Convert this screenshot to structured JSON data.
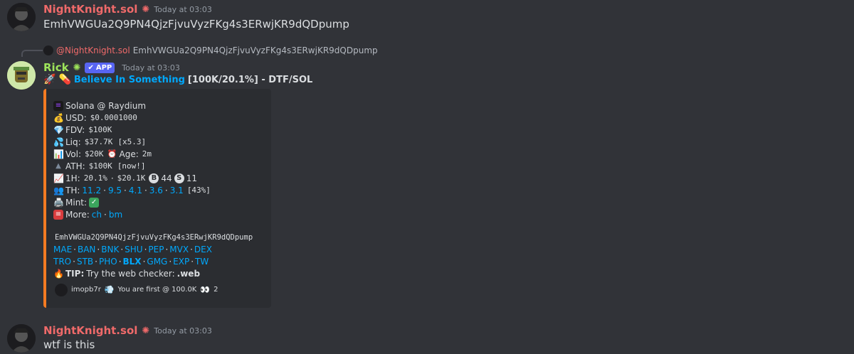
{
  "messages": [
    {
      "username": "NightKnight.sol",
      "timestamp": "Today at 03:03",
      "text": "EmhVWGUa2Q9PN4QjzFjvuVyzFKg4s3ERwjKR9dQDpump"
    },
    {
      "reply": {
        "mention": "@NightKnight.sol",
        "text": "EmhVWGUa2Q9PN4QjzFjvuVyzFKg4s3ERwjKR9dQDpump"
      },
      "username": "Rick",
      "badge": "APP",
      "timestamp": "Today at 03:03",
      "header": {
        "title_link": "Believe In Something",
        "title_rest": "[100K/20.1%] - DTF/SOL"
      },
      "embed": {
        "chain": "Solana @ Raydium",
        "usd_label": "USD:",
        "usd_value": "$0.0001000",
        "fdv_label": "FDV:",
        "fdv_value": "$100K",
        "liq_label": "Liq:",
        "liq_value": "$37.7K",
        "liq_mult": "[x5.3]",
        "vol_label": "Vol:",
        "vol_value": "$20K",
        "age_label": "Age:",
        "age_value": "2m",
        "ath_label": "ATH:",
        "ath_value": "$100K",
        "ath_note": "[now!]",
        "h1_label": "1H:",
        "h1_pct": "20.1%",
        "h1_sep": "·",
        "h1_vol": "$20.1K",
        "buys": "44",
        "sells": "11",
        "th_label": "TH:",
        "th_values": [
          "11.2",
          "9.5",
          "4.1",
          "3.6",
          "3.1"
        ],
        "th_total": "[43%]",
        "mint_label": "Mint:",
        "more_label": "More:",
        "more_links": [
          "ch",
          "bm"
        ],
        "contract": "EmhVWGUa2Q9PN4QjzFjvuVyzFKg4s3ERwjKR9dQDpump",
        "links_row1": [
          "MAE",
          "BAN",
          "BNK",
          "SHU",
          "PEP",
          "MVX",
          "DEX"
        ],
        "links_row2": [
          "TRO",
          "STB",
          "PHO",
          "BLX",
          "GMG",
          "EXP",
          "TW"
        ],
        "tip_label": "TIP:",
        "tip_text": "Try the web checker:",
        "tip_cmd": ".web",
        "footer_user": "imopb7r",
        "footer_text": "You are first @ 100.0K",
        "footer_count": "2"
      }
    },
    {
      "username": "NightKnight.sol",
      "timestamp": "Today at 03:03",
      "text": "wtf is this"
    }
  ],
  "colors": {
    "background": "#313338",
    "username_nightknight": "#f06a6a",
    "username_rick": "#9ee55a",
    "link": "#00a8fc",
    "embed_border": "#f47b22",
    "app_badge": "#5865f2"
  }
}
